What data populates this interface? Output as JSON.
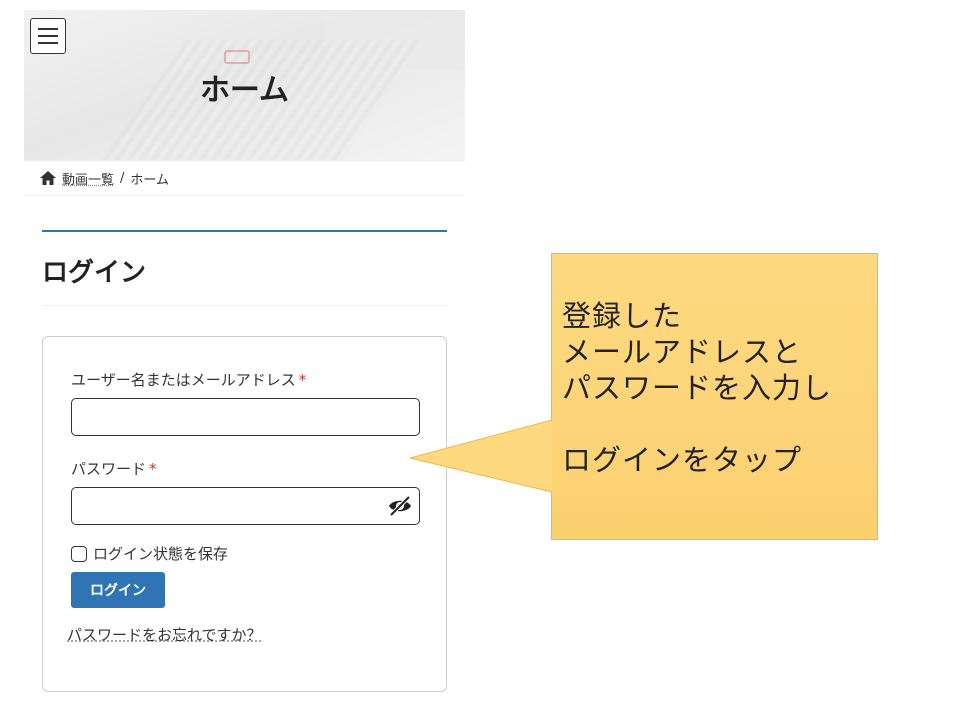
{
  "header": {
    "title": "ホーム",
    "menu_icon": "hamburger-menu-icon"
  },
  "breadcrumb": {
    "home_icon": "home-icon",
    "link_label": "動画一覧",
    "separator": "/",
    "current": "ホーム"
  },
  "login": {
    "heading": "ログイン",
    "username_label": "ユーザー名またはメールアドレス",
    "username_value": "",
    "password_label": "パスワード",
    "password_value": "",
    "required_mark": "*",
    "eye_icon": "eye-slash-icon",
    "remember_label": "ログイン状態を保存",
    "remember_checked": false,
    "submit_label": "ログイン",
    "forgot_label": "パスワードをお忘れですか？"
  },
  "callout": {
    "lines": [
      "登録した",
      "メールアドレスと",
      "パスワードを入力し",
      "",
      "ログインをタップ"
    ],
    "color": "#fdd47a"
  },
  "colors": {
    "accent": "#2f75b5",
    "required": "#c0392b"
  }
}
